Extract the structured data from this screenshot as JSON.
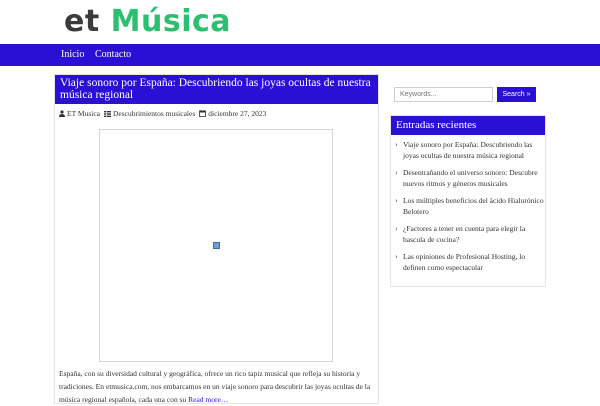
{
  "site": {
    "logo_part1": "et",
    "logo_part2": "Música"
  },
  "nav": {
    "items": [
      "Inicio",
      "Contacto"
    ]
  },
  "post": {
    "title": "Viaje sonoro por España: Descubriendo las joyas ocultas de nuestra música regional",
    "author": "ET Musica",
    "category": "Descubrimientos musicales",
    "date": "diciembre 27, 2023",
    "excerpt": "España, con su diversidad cultural y geográfica, ofrece un rico tapiz musical que refleja su historia y tradiciones. En etmusica.com, nos embarcamos en un viaje sonoro para descubrir las joyas ocultas de la música regional española, cada una con su",
    "read_more": "Read more…"
  },
  "search": {
    "placeholder": "Keywords...",
    "button": "Search »"
  },
  "recent": {
    "title": "Entradas recientes",
    "items": [
      "Viaje sonoro por España: Descubriendo las joyas ocultas de nuestra música regional",
      "Desentrañando el universo sonoro: Descubre nuevos ritmos y géneros musicales",
      "Los múltiples beneficios del ácido Hialurónico Belotero",
      "¿Factores a tener en cuenta para elegir la bascula de cocina?",
      "Las opiniones de Profesional Hosting, lo definen como espectacular"
    ]
  },
  "colors": {
    "brand": "#2a0fd4",
    "logo_accent": "#2bbf6f"
  },
  "icons": [
    "user-icon",
    "category-icon",
    "calendar-icon",
    "broken-image-icon",
    "chevron-right-icon"
  ]
}
